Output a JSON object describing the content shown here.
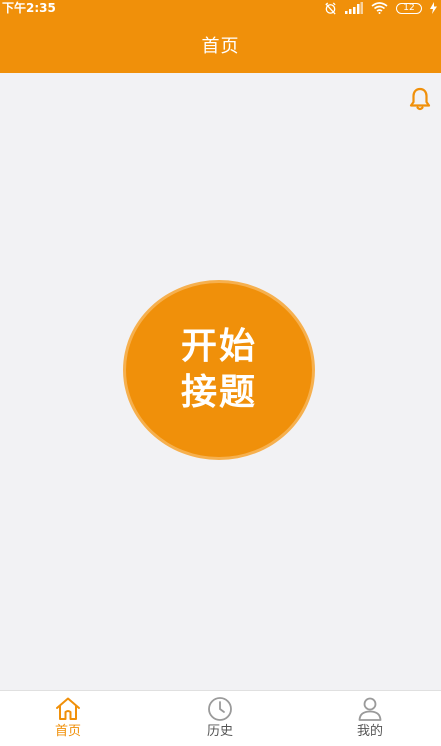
{
  "status_bar": {
    "time": "下午2:35",
    "battery": "12",
    "icons": [
      "alarm-off-icon",
      "signal-icon",
      "wifi-icon",
      "battery-icon",
      "charging-icon"
    ]
  },
  "header": {
    "title": "首页"
  },
  "notification": {
    "icon": "bell-icon"
  },
  "main": {
    "start_button": {
      "line1": "开始",
      "line2": "接题"
    }
  },
  "tabs": [
    {
      "label": "首页",
      "icon": "home-icon",
      "active": true
    },
    {
      "label": "历史",
      "icon": "clock-icon",
      "active": false
    },
    {
      "label": "我的",
      "icon": "user-icon",
      "active": false
    }
  ],
  "colors": {
    "primary": "#f0900a",
    "background": "#f2f2f4",
    "tab_inactive": "#555555"
  }
}
